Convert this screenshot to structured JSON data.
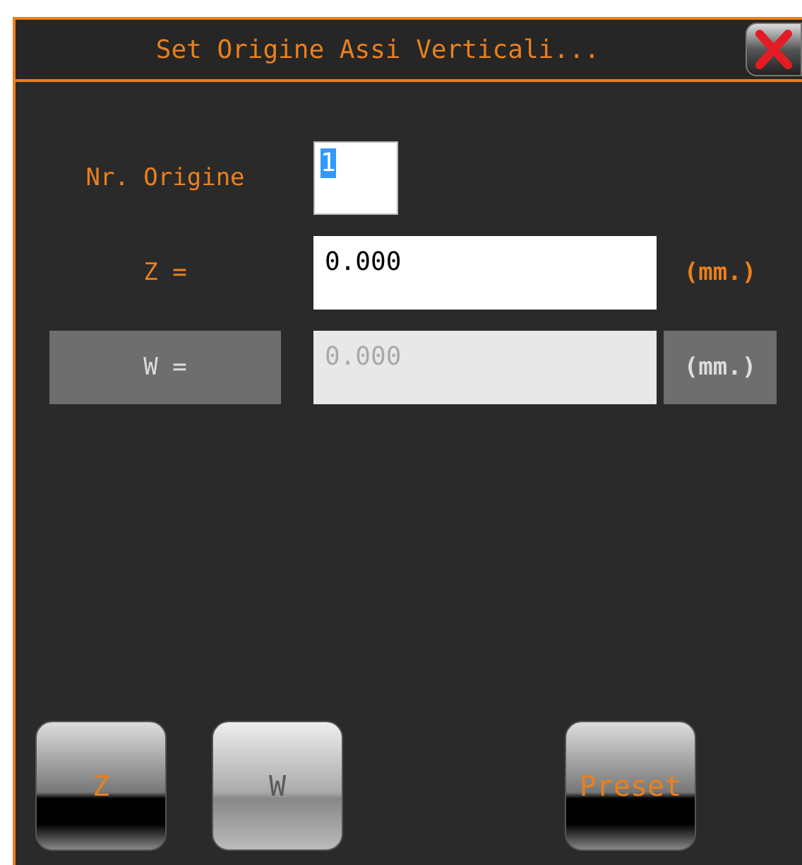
{
  "window": {
    "title": "Set Origine Assi Verticali..."
  },
  "origin": {
    "label": "Nr. Origine",
    "value": "1",
    "text_selected": true
  },
  "axes": [
    {
      "label": "Z =",
      "value": "0.000",
      "unit": "(mm.)",
      "disabled": false
    },
    {
      "label": "W =",
      "value": "0.000",
      "unit": "(mm.)",
      "disabled": true
    }
  ],
  "buttons": [
    {
      "label": "Z",
      "disabled": false
    },
    {
      "label": "W",
      "disabled": true
    },
    {
      "label": "Preset",
      "disabled": false
    }
  ]
}
